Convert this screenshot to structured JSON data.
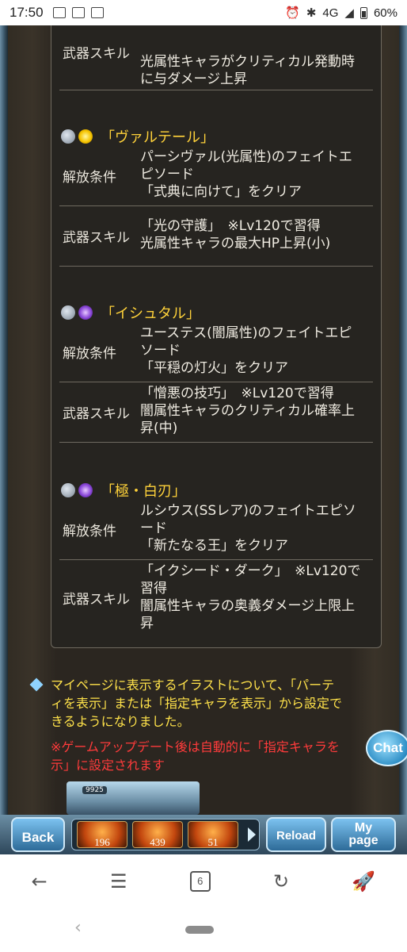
{
  "status_bar": {
    "time": "17:50",
    "network": "4G",
    "battery": "60%"
  },
  "panel": {
    "top_row": {
      "label": "武器スキル",
      "lines": [
        "光属性キャラがクリティカル発動時",
        "に与ダメージ上昇"
      ]
    },
    "characters": [
      {
        "name": "「ヴァルテール」",
        "element": "light",
        "unlock_label": "解放条件",
        "unlock_lines": [
          "パーシヴァル(光属性)のフェイトエ",
          "ピソード",
          "「式典に向けて」をクリア"
        ],
        "skill_label": "武器スキル",
        "skill_lines": [
          "「光の守護」　※Lv120で習得",
          "光属性キャラの最大HP上昇(小)"
        ]
      },
      {
        "name": "「イシュタル」",
        "element": "dark",
        "unlock_label": "解放条件",
        "unlock_lines": [
          "ユーステス(闇属性)のフェイトエピ",
          "ソード",
          "「平穏の灯火」をクリア"
        ],
        "skill_label": "武器スキル",
        "skill_lines": [
          "「憎悪の技巧」　※Lv120で習得",
          "闇属性キャラのクリティカル確率上",
          "昇(中)"
        ]
      },
      {
        "name": "「極・白刃」",
        "element": "dark",
        "unlock_label": "解放条件",
        "unlock_lines": [
          "ルシウス(SSレア)のフェイトエピソ",
          "ード",
          "「新たなる王」をクリア"
        ],
        "skill_label": "武器スキル",
        "skill_lines": [
          "「イクシード・ダーク」　※Lv120で",
          "習得",
          "闇属性キャラの奥義ダメージ上限上",
          "昇"
        ]
      }
    ]
  },
  "notice": {
    "lines": [
      "マイページに表示するイラストについて、「パーテ",
      "ィを表示」または「指定キャラを表示」から設定で",
      "きるようになりました。"
    ],
    "red_lines": [
      "※ゲームアップデート後は自動的に「指定キャラを",
      "示」に設定されます"
    ]
  },
  "chat_label": "Chat",
  "banner_hp": "9925",
  "toolbar": {
    "back_label": "Back",
    "reload_label": "Reload",
    "mypage_line1": "My",
    "mypage_line2": "page",
    "items": [
      "196",
      "439",
      "51"
    ]
  },
  "browser": {
    "tab_count": "6"
  }
}
